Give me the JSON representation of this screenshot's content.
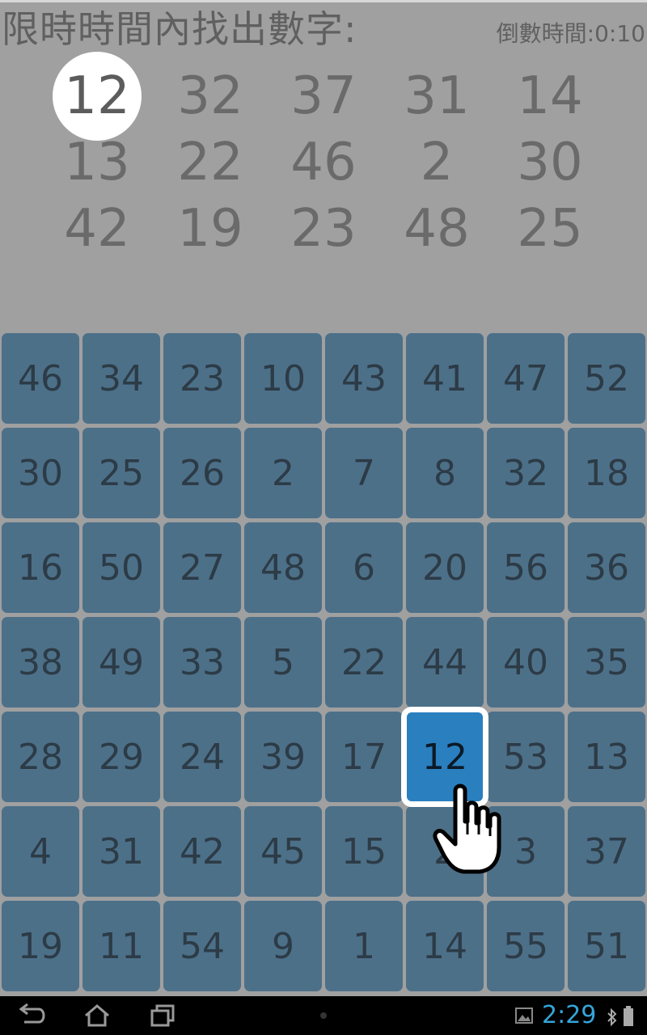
{
  "header": {
    "instruction": "限時時間內找出數字:",
    "timer_label": "倒數時間:",
    "timer_value": "0:10"
  },
  "targets": [
    "12",
    "32",
    "37",
    "31",
    "14",
    "13",
    "22",
    "46",
    "2",
    "30",
    "42",
    "19",
    "23",
    "48",
    "25"
  ],
  "current_target_index": 0,
  "board": {
    "cells": [
      "46",
      "34",
      "23",
      "10",
      "43",
      "41",
      "47",
      "52",
      "30",
      "25",
      "26",
      "2",
      "7",
      "8",
      "32",
      "18",
      "16",
      "50",
      "27",
      "48",
      "6",
      "20",
      "56",
      "36",
      "38",
      "49",
      "33",
      "5",
      "22",
      "44",
      "40",
      "35",
      "28",
      "29",
      "24",
      "39",
      "17",
      "12",
      "53",
      "13",
      "4",
      "31",
      "42",
      "45",
      "15",
      "2",
      "3",
      "37",
      "19",
      "11",
      "54",
      "9",
      "1",
      "14",
      "55",
      "51"
    ],
    "selected_index": 37
  },
  "statusbar": {
    "time": "2:29",
    "icons": [
      "back-icon",
      "home-icon",
      "recent-apps-icon",
      "gallery-icon",
      "bluetooth-icon",
      "battery-icon"
    ]
  }
}
